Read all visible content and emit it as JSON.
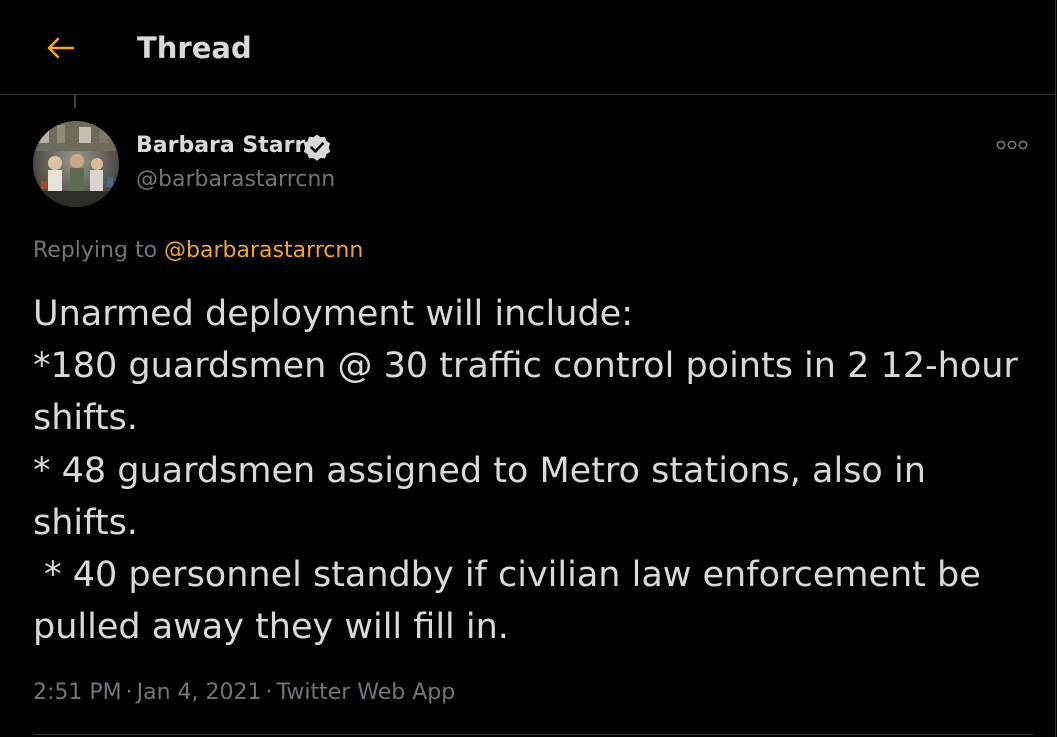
{
  "colors": {
    "background": "#000000",
    "accent": "#f5a623",
    "text_primary": "#d9d9d9",
    "text_secondary": "#6e767d",
    "border": "#2f3336"
  },
  "header": {
    "back_icon": "arrow-left-icon",
    "title": "Thread"
  },
  "tweet": {
    "author": {
      "name": "Barbara Starr",
      "handle": "@barbarastarrcnn",
      "verified_icon": "verified-badge-icon",
      "avatar_icon": "avatar-photo"
    },
    "more_icon": "more-options-icon",
    "replying_prefix": "Replying to",
    "replying_to": "@barbarastarrcnn",
    "text": "Unarmed deployment will include:\n*180 guardsmen @ 30 traffic control points in 2 12-hour shifts.\n* 48 guardsmen assigned to Metro stations, also in shifts.\n * 40 personnel standby if civilian law enforcement be pulled away they will fill in.",
    "time": "2:51 PM",
    "separator": "·",
    "date": "Jan 4, 2021",
    "source": "Twitter Web App"
  }
}
